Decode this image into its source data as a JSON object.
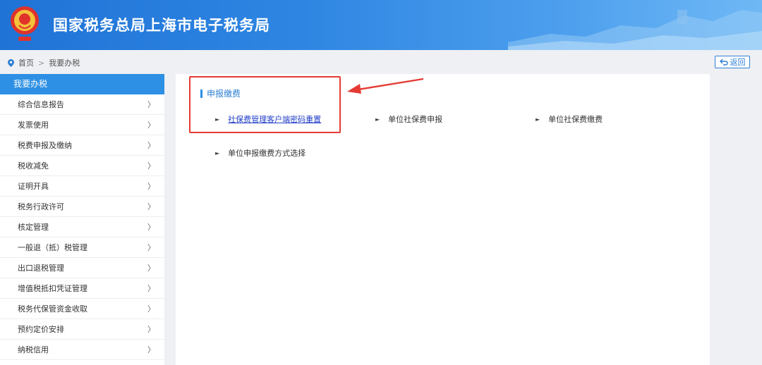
{
  "header": {
    "title": "国家税务总局上海市电子税务局",
    "emblem_caption": "中国税务"
  },
  "breadcrumb": {
    "home": "首页",
    "separator": ">",
    "current": "我要办税"
  },
  "back_button": {
    "label": "返回",
    "icon": "return-arrow-icon"
  },
  "sidebar": {
    "header": "我要办税",
    "items": [
      {
        "label": "综合信息报告"
      },
      {
        "label": "发票使用"
      },
      {
        "label": "税费申报及缴纳"
      },
      {
        "label": "税收减免"
      },
      {
        "label": "证明开具"
      },
      {
        "label": "税务行政许可"
      },
      {
        "label": "核定管理"
      },
      {
        "label": "一般退（抵）税管理"
      },
      {
        "label": "出口退税管理"
      },
      {
        "label": "增值税抵扣凭证管理"
      },
      {
        "label": "税务代保管资金收取"
      },
      {
        "label": "预约定价安排"
      },
      {
        "label": "纳税信用"
      }
    ],
    "chevron": "〉"
  },
  "content": {
    "section_title": "申报缴费",
    "links": [
      {
        "label": "社保费管理客户端密码重置",
        "highlighted": true
      },
      {
        "label": "单位社保费申报"
      },
      {
        "label": "单位社保费缴费"
      },
      {
        "label": "单位申报缴费方式选择"
      }
    ]
  },
  "colors": {
    "header_blue": "#1f73d6",
    "sidebar_active": "#2e90e4",
    "annotation_red": "#e53b34",
    "link_blue": "#2440c8"
  }
}
